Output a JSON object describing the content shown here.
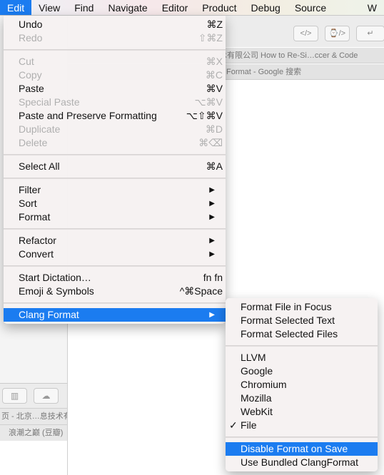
{
  "menubar": [
    "Edit",
    "View",
    "Find",
    "Navigate",
    "Editor",
    "Product",
    "Debug",
    "Source Control",
    "W"
  ],
  "toolbar_buttons": [
    "</>",
    "⌚/>",
    "↵"
  ],
  "tabs": {
    "row1": "术有限公司    How to Re-Si…ccer & Code",
    "row2": "Format - Google 搜索"
  },
  "left_window": {
    "row1": "页 - 北京…息技术有",
    "row2": "浪潮之巅 (豆瓣)"
  },
  "edit_menu": [
    {
      "label": "Undo",
      "shortcut": "⌘Z"
    },
    {
      "label": "Redo",
      "shortcut": "⇧⌘Z",
      "disabled": true
    },
    {
      "sep": true
    },
    {
      "label": "Cut",
      "shortcut": "⌘X",
      "disabled": true
    },
    {
      "label": "Copy",
      "shortcut": "⌘C",
      "disabled": true
    },
    {
      "label": "Paste",
      "shortcut": "⌘V"
    },
    {
      "label": "Special Paste",
      "shortcut": "⌥⌘V",
      "disabled": true
    },
    {
      "label": "Paste and Preserve Formatting",
      "shortcut": "⌥⇧⌘V"
    },
    {
      "label": "Duplicate",
      "shortcut": "⌘D",
      "disabled": true
    },
    {
      "label": "Delete",
      "shortcut": "⌘⌫",
      "disabled": true
    },
    {
      "sep": true
    },
    {
      "label": "Select All",
      "shortcut": "⌘A"
    },
    {
      "sep": true
    },
    {
      "label": "Filter",
      "submenu": true
    },
    {
      "label": "Sort",
      "submenu": true
    },
    {
      "label": "Format",
      "submenu": true
    },
    {
      "sep": true
    },
    {
      "label": "Refactor",
      "submenu": true
    },
    {
      "label": "Convert",
      "submenu": true
    },
    {
      "sep": true
    },
    {
      "label": "Start Dictation…",
      "shortcut": "fn fn"
    },
    {
      "label": "Emoji & Symbols",
      "shortcut": "^⌘Space"
    },
    {
      "sep": true
    },
    {
      "label": "Clang Format",
      "submenu": true,
      "selected": true
    }
  ],
  "clang_submenu": [
    {
      "label": "Format File in Focus"
    },
    {
      "label": "Format Selected Text"
    },
    {
      "label": "Format Selected Files"
    },
    {
      "sep": true
    },
    {
      "label": "LLVM"
    },
    {
      "label": "Google"
    },
    {
      "label": "Chromium"
    },
    {
      "label": "Mozilla"
    },
    {
      "label": "WebKit"
    },
    {
      "label": "File",
      "checked": true
    },
    {
      "sep": true
    },
    {
      "label": "Disable Format on Save",
      "selected": true
    },
    {
      "label": "Use Bundled ClangFormat"
    }
  ],
  "colors": {
    "highlight": "#1b7cf0"
  }
}
